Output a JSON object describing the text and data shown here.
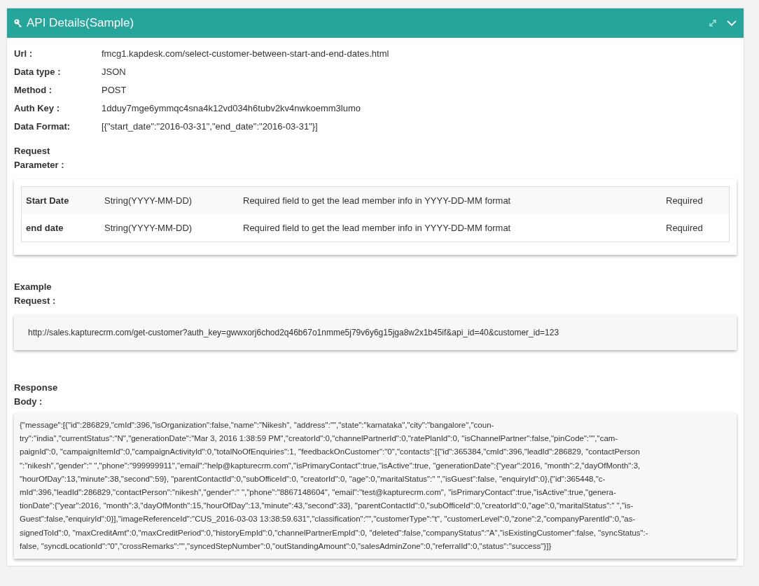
{
  "panel": {
    "title": "API Details(Sample)",
    "expanded": true
  },
  "fields": [
    {
      "label": "Url :",
      "value": "fmcg1.kapdesk.com/select-customer-between-start-and-end-dates.html"
    },
    {
      "label": "Data type :",
      "value": "JSON"
    },
    {
      "label": "Method :",
      "value": "POST"
    },
    {
      "label": "Auth Key :",
      "value": "1dduy7mge6ymmqc4sna4k12vd034h6tubv2kv4nwkoemm3lumo"
    },
    {
      "label": "Data Format:",
      "value": "[{\"start_date\":\"2016-03-31\",\"end_date\":\"2016-03-31\"}]"
    }
  ],
  "request_parameter": {
    "label_lines": [
      "Request",
      "Parameter :"
    ],
    "rows": [
      {
        "name": "Start Date",
        "type": "String(YYYY-MM-DD)",
        "description": "Required field to get the lead member info in YYYY-DD-MM format",
        "requirement": "Required"
      },
      {
        "name": "end date",
        "type": "String(YYYY-MM-DD)",
        "description": "Required field to get the lead member info in YYYY-DD-MM format",
        "requirement": "Required"
      }
    ]
  },
  "example_request": {
    "label_lines": [
      "Example",
      "Request :"
    ],
    "text": "http://sales.kapturecrm.com/get-customer?auth_key=gwwxorj6chod2q46b67o1nmme5j79v6y6g15jga8w2x1b45if&api_id=40&customer_id=123"
  },
  "response_body": {
    "label_lines": [
      "Response",
      "Body :"
    ],
    "lines": [
      "{\"message\":[{\"id\":286829,\"cmId\":396,\"isOrganization\":false,\"name\":\"Nikesh\", \"address\":\"\",\"state\":\"karnataka\",\"city\":\"bangalore\",\"coun-",
      "try\":\"india\",\"currentStatus\":\"N\",\"generationDate\":\"Mar 3, 2016 1:38:59 PM\",\"creatorId\":0,\"channelPartnerId\":0,\"ratePlanId\":0, \"isChannelPartner\":false,\"pinCode\":\"\",\"cam-",
      "paignId\":0, \"campaignItemId\":0,\"campaignActivityId\":0,\"totalNoOfEnquiries\":1, \"feedbackOnCustomer\":\"0\",\"contacts\":[{\"id\":365384,\"cmId\":396,\"leadId\":286829, \"contactPerson",
      "\":\"nikesh\",\"gender\":\" \",\"phone\":\"999999911\",\"email\":\"help@kapturecrm.com\",\"isPrimaryContact\":true,\"isActive\":true, \"generationDate\":{\"year\":2016, \"month\":2,\"dayOfMonth\":3,",
      "\"hourOfDay\":13,\"minute\":38,\"second\":59}, \"parentContactId\":0,\"subOfficeId\":0, \"creatorId\":0, \"age\":0,\"maritalStatus\":\" \",\"isGuest\":false, \"enquiryId\":0},{\"id\":365448,\"c-",
      "mId\":396,\"leadId\":286829,\"contactPerson\":\"nikesh\",\"gender\":\" \",\"phone\":\"8867148604\", \"email\":\"test@kapturecrm.com\", \"isPrimaryContact\":true,\"isActive\":true,\"genera-",
      "tionDate\":{\"year\":2016, \"month\":3,\"dayOfMonth\":15,\"hourOfDay\":13,\"minute\":43,\"second\":33}, \"parentContactId\":0,\"subOfficeId\":0,\"creatorId\":0,\"age\":0,\"maritalStatus\":\" \",\"is-",
      "Guest\":false,\"enquiryId\":0}],\"imageReferenceId\":\"CUS_2016-03-03 13:38:59.631\",\"classification\":\"\",\"customerType\":\"t\", \"customerLevel\":0,\"zone\":2,\"companyParentId\":0,\"as-",
      "signedToId\":0, \"maxCreditAmt\":0,\"maxCreditPeriod\":0,\"historyEmpId\":0,\"channelPartnerEmpId\":0, \"deleted\":false,\"companyStatus\":\"A\",\"isExistingCustomer\":false, \"syncStatus\":-",
      "false, \"syncdLocationId\":\"0\",\"crossRemarks\":\"\",\"syncedStepNumber\":0,\"outStandingAmount\":0,\"salesAdminZone\":0,\"referralId\":0,\"status\":\"success\"}]}"
    ]
  }
}
